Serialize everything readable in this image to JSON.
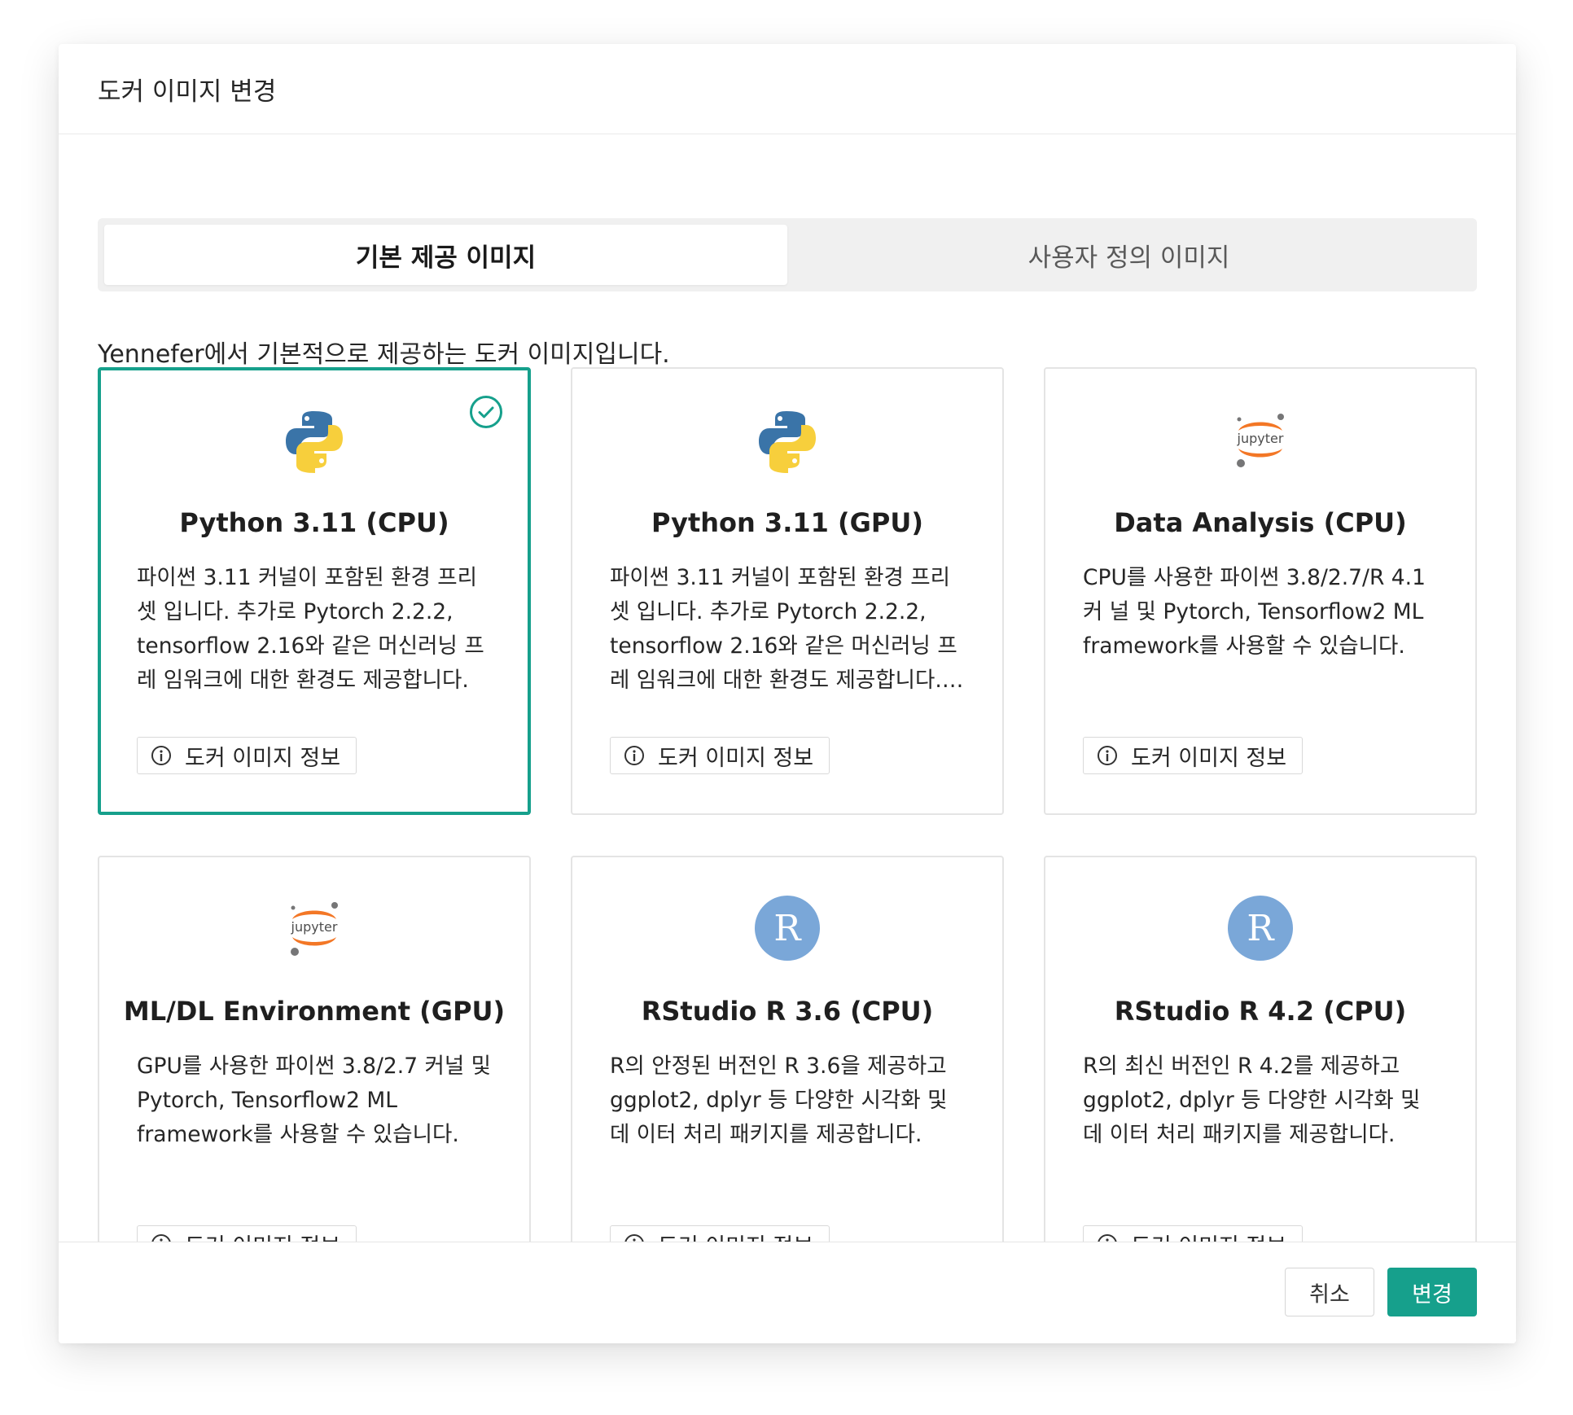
{
  "dialog": {
    "title": "도커 이미지 변경",
    "tabs": [
      "기본 제공 이미지",
      "사용자 정의 이미지"
    ],
    "intro": "Yennefer에서 기본적으로 제공하는 도커 이미지입니다.",
    "info_button_label": "도커 이미지 정보",
    "cards": [
      {
        "icon": "python-logo-icon",
        "title": "Python 3.11 (CPU)",
        "description": "파이썬 3.11 커널이 포함된 환경 프리셋 입니다. 추가로 Pytorch 2.2.2, tensorflow 2.16와 같은 머신러닝 프레 임워크에 대한 환경도 제공합니다.",
        "selected": true
      },
      {
        "icon": "python-logo-icon",
        "title": "Python 3.11 (GPU)",
        "description": "파이썬 3.11 커널이 포함된 환경 프리셋 입니다. 추가로 Pytorch 2.2.2, tensorflow 2.16와 같은 머신러닝 프레 임워크에 대한 환경도 제공합니다. GP...",
        "selected": false
      },
      {
        "icon": "jupyter-logo-icon",
        "title": "Data Analysis (CPU)",
        "description": "CPU를 사용한 파이썬 3.8/2.7/R 4.1 커 널 및 Pytorch, Tensorflow2 ML framework를 사용할 수 있습니다.",
        "selected": false
      },
      {
        "icon": "jupyter-logo-icon",
        "title": "ML/DL Environment (GPU)",
        "description": "GPU를 사용한 파이썬 3.8/2.7 커널 및 Pytorch, Tensorflow2 ML framework를 사용할 수 있습니다.",
        "selected": false
      },
      {
        "icon": "r-logo-icon",
        "title": "RStudio R 3.6 (CPU)",
        "description": "R의 안정된 버전인 R 3.6을 제공하고 ggplot2, dplyr 등 다양한 시각화 및 데 이터 처리 패키지를 제공합니다.",
        "selected": false
      },
      {
        "icon": "r-logo-icon",
        "title": "RStudio R 4.2 (CPU)",
        "description": "R의 최신 버전인 R 4.2를 제공하고 ggplot2, dplyr 등 다양한 시각화 및 데 이터 처리 패키지를 제공합니다.",
        "selected": false
      }
    ],
    "footer": {
      "cancel": "취소",
      "confirm": "변경"
    },
    "colors": {
      "accent": "#16a08c",
      "python_blue": "#3a74a8",
      "python_yellow": "#f7cf3c",
      "jupyter_orange": "#f37726",
      "r_blue": "#7aa7d8"
    }
  }
}
